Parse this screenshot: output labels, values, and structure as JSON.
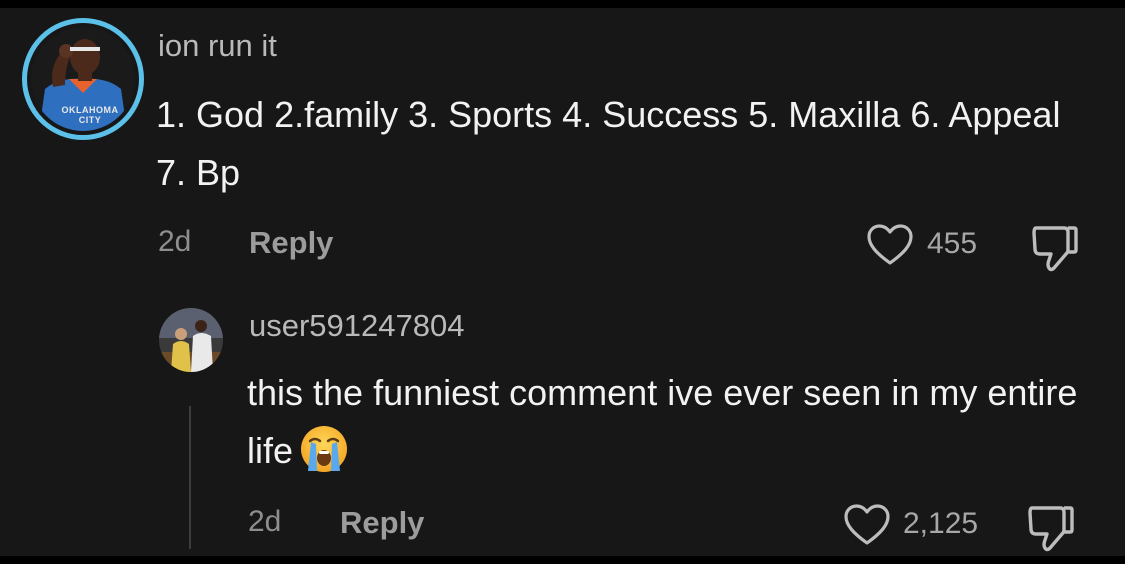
{
  "comment": {
    "username": "ion run it",
    "text": "1. God 2.family 3. Sports 4. Success 5. Maxilla 6. Appeal 7. Bp",
    "avatar_jersey_text_line1": "OKLAHOMA",
    "avatar_jersey_text_line2": "CITY",
    "time": "2d",
    "reply_label": "Reply",
    "likes": "455",
    "avatar_ring_color": "#5cc1e8"
  },
  "reply": {
    "username": "user591247804",
    "text": "this the funniest comment ive ever seen in my entire life",
    "emoji": "loudly-crying-face",
    "time": "2d",
    "reply_label": "Reply",
    "likes": "2,125"
  },
  "icons": {
    "like": "heart-outline-icon",
    "dislike": "thumbs-down-outline-icon"
  },
  "colors": {
    "background": "#171717",
    "primary_text": "#f2f2f2",
    "secondary_text": "#8e8e8e"
  }
}
